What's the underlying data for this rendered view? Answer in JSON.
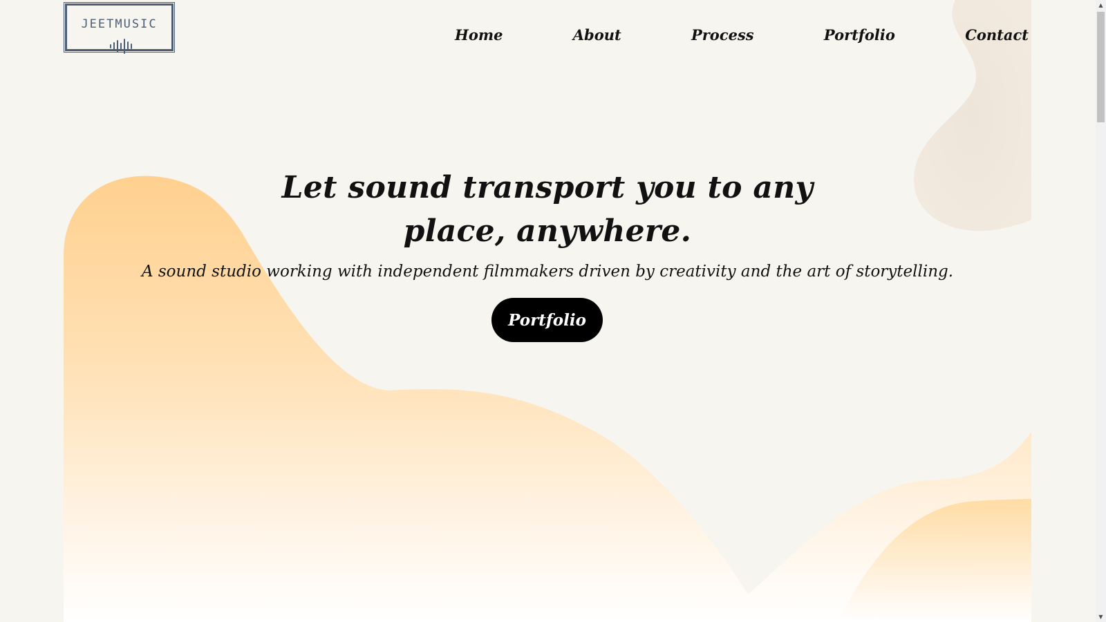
{
  "logo": {
    "text": "JEETMUSIC",
    "icon": "sound-wave-icon"
  },
  "nav": {
    "items": [
      {
        "label": "Home"
      },
      {
        "label": "About"
      },
      {
        "label": "Process"
      },
      {
        "label": "Portfolio"
      },
      {
        "label": "Contact"
      }
    ]
  },
  "hero": {
    "title": "Let sound transport you to any place, anywhere.",
    "subtitle": "A sound studio working with independent filmmakers driven by creativity and the art of storytelling.",
    "cta_label": "Portfolio"
  },
  "colors": {
    "background": "#f6f5f0",
    "accent_wave": "#ffd08f",
    "logo": "#4d5d75",
    "button": "#000000"
  },
  "scrollbar": {
    "up_icon": "▲",
    "down_icon": "▼"
  }
}
